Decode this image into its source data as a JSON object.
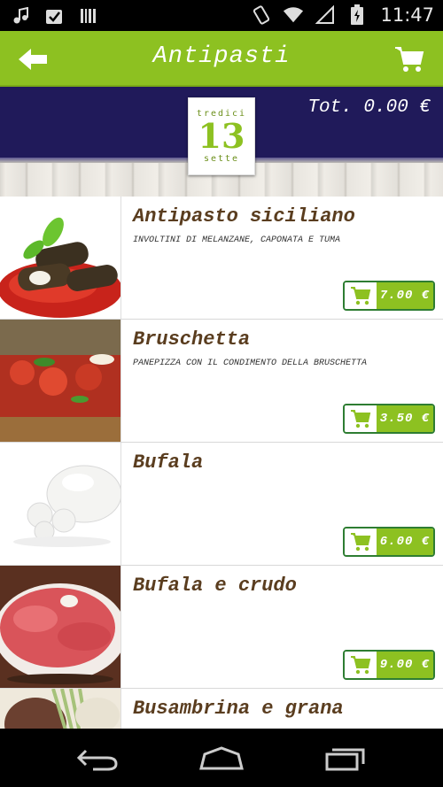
{
  "status_bar": {
    "time": "11:47",
    "icons": [
      "music-note-icon",
      "checkbox-icon",
      "barcode-icon",
      "vibrate-icon",
      "wifi-icon",
      "signal-icon",
      "battery-icon"
    ]
  },
  "action_bar": {
    "title": "Antipasti",
    "back_icon": "arrow-left-icon",
    "cart_icon": "shopping-cart-icon"
  },
  "header": {
    "total_label": "Tot. 0.00 €",
    "logo": {
      "top": "tredici",
      "number": "13",
      "bottom": "sette"
    }
  },
  "menu": {
    "items": [
      {
        "name": "Antipasto siciliano",
        "description": "INVOLTINI DI MELANZANE, CAPONATA E TUMA",
        "price": "7.00 €"
      },
      {
        "name": "Bruschetta",
        "description": "PANEPIZZA CON IL CONDIMENTO DELLA BRUSCHETTA",
        "price": "3.50 €"
      },
      {
        "name": "Bufala",
        "description": "",
        "price": "6.00 €"
      },
      {
        "name": "Bufala e crudo",
        "description": "",
        "price": "9.00 €"
      },
      {
        "name": "Busambrina e grana",
        "description": "",
        "price": ""
      }
    ]
  },
  "colors": {
    "accent_green": "#8dc121",
    "header_navy": "#201a5a",
    "name_brown": "#5a3d1f",
    "button_border": "#2e7d32"
  },
  "nav_bar": {
    "icons": [
      "back-nav-icon",
      "home-nav-icon",
      "recents-nav-icon"
    ]
  }
}
